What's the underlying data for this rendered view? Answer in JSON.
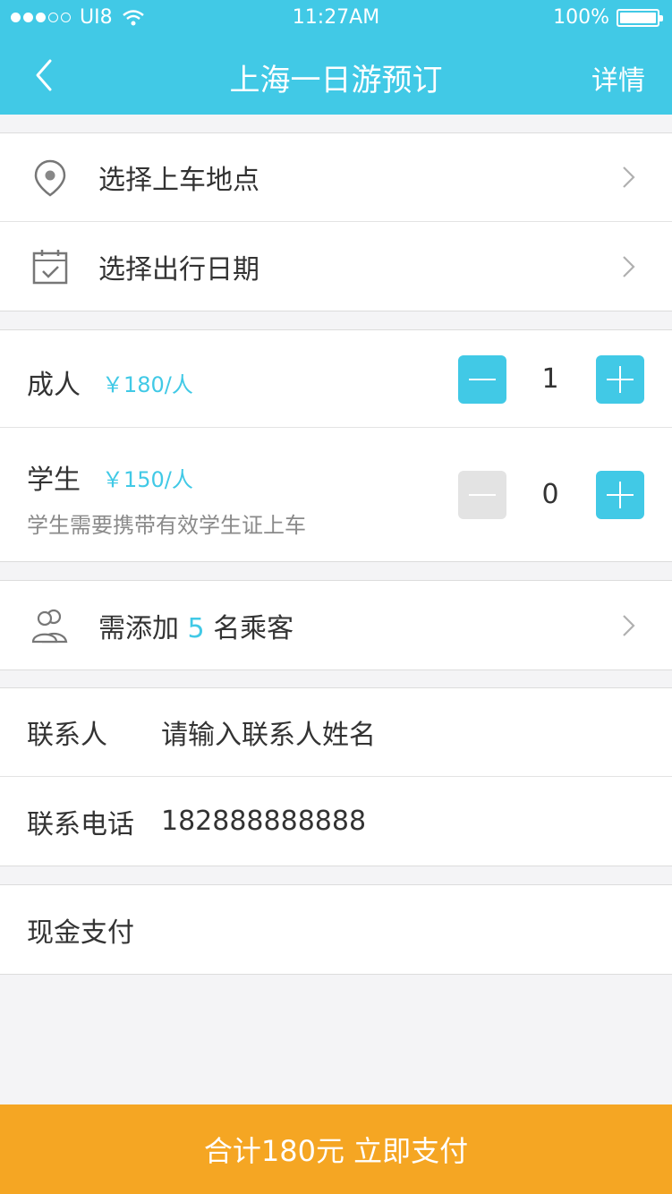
{
  "status_bar": {
    "carrier": "UI8",
    "time": "11:27AM",
    "battery": "100%"
  },
  "nav": {
    "title": "上海一日游预订",
    "detail": "详情"
  },
  "selection": [
    {
      "label": "选择上车地点",
      "icon": "location-pin-icon"
    },
    {
      "label": "选择出行日期",
      "icon": "calendar-icon"
    }
  ],
  "tickets": {
    "adult": {
      "label": "成人",
      "price": "￥180/人",
      "qty": "1"
    },
    "student": {
      "label": "学生",
      "price": "￥150/人",
      "qty": "0",
      "note": "学生需要携带有效学生证上车"
    }
  },
  "passengers": {
    "prefix": "需添加",
    "count": "5",
    "suffix": "名乘客",
    "icon": "people-icon"
  },
  "contact": {
    "name_label": "联系人",
    "name_placeholder": "请输入联系人姓名",
    "phone_label": "联系电话",
    "phone_value": "182888888888"
  },
  "payment": {
    "method": "现金支付"
  },
  "pay_button": {
    "label": "合计180元 立即支付"
  },
  "colors": {
    "accent": "#41c9e6",
    "pay": "#f5a623"
  }
}
